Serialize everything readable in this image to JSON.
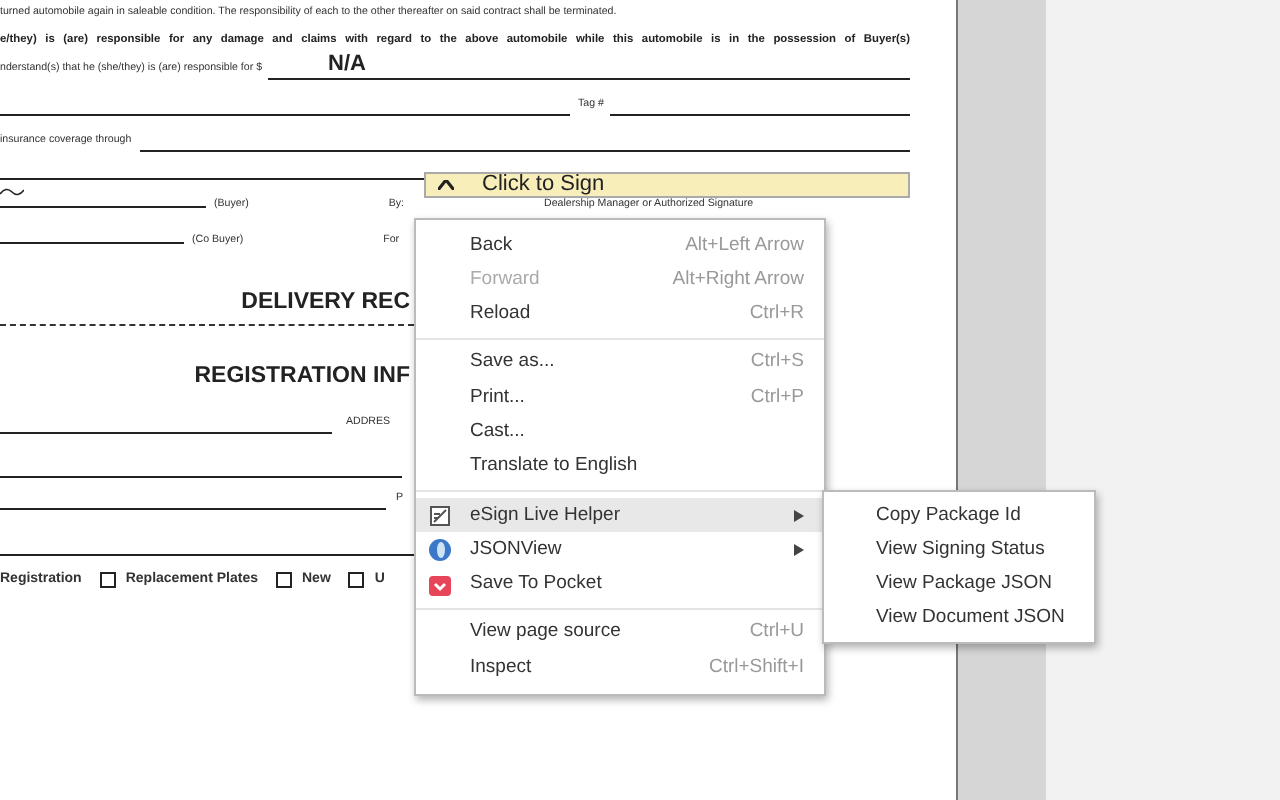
{
  "document": {
    "paragraph_1": "turned automobile again in saleable condition. The responsibility of each to the other thereafter on said contract shall be terminated.",
    "paragraph_2": "e/they) is (are) responsible for any damage and claims with regard to the above automobile while this automobile is in the possession of Buyer(s)",
    "amount_label": "nderstand(s) that he (she/they) is (are) responsible for $",
    "amount_value": "N/A",
    "tag_label": "Tag #",
    "insurance_label": "insurance coverage through",
    "buyer_label": "(Buyer)",
    "by_label": "By:",
    "sign_button": "Click to Sign",
    "signature_caption": "Dealership Manager or Authorized Signature",
    "co_buyer_label": "(Co Buyer)",
    "for_label": "For",
    "heading_1": "DELIVERY REC",
    "heading_2": "REGISTRATION INF",
    "address_label": "ADDRES",
    "po_label": "P",
    "registration_label": "Registration",
    "options": [
      {
        "label": "Replacement Plates",
        "checked": false
      },
      {
        "label": "New",
        "checked": false
      },
      {
        "label": "U",
        "checked": false
      }
    ]
  },
  "context_menu": {
    "items": [
      {
        "kind": "item",
        "label": "Back",
        "shortcut": "Alt+Left Arrow",
        "disabled": false,
        "selected": false
      },
      {
        "kind": "item",
        "label": "Forward",
        "shortcut": "Alt+Right Arrow",
        "disabled": true,
        "selected": false
      },
      {
        "kind": "item",
        "label": "Reload",
        "shortcut": "Ctrl+R",
        "disabled": false,
        "selected": false
      },
      {
        "kind": "separator"
      },
      {
        "kind": "item",
        "label": "Save as...",
        "shortcut": "Ctrl+S",
        "disabled": false,
        "selected": false
      },
      {
        "kind": "item",
        "label": "Print...",
        "shortcut": "Ctrl+P",
        "disabled": false,
        "selected": false
      },
      {
        "kind": "item",
        "label": "Cast...",
        "disabled": false,
        "selected": false
      },
      {
        "kind": "item",
        "label": "Translate to English",
        "disabled": false,
        "selected": false
      },
      {
        "kind": "separator"
      },
      {
        "kind": "extension",
        "label": "eSign Live Helper",
        "has_submenu": true,
        "disabled": false,
        "selected": true
      },
      {
        "kind": "extension",
        "label": "JSONView",
        "has_submenu": true,
        "disabled": false,
        "selected": false
      },
      {
        "kind": "extension",
        "label": "Save To Pocket",
        "disabled": false,
        "selected": false
      },
      {
        "kind": "separator"
      },
      {
        "kind": "item",
        "label": "View page source",
        "shortcut": "Ctrl+U",
        "disabled": false,
        "selected": false
      },
      {
        "kind": "item",
        "label": "Inspect",
        "shortcut": "Ctrl+Shift+I",
        "disabled": false,
        "selected": false
      }
    ]
  },
  "submenu": {
    "items": [
      {
        "label": "Copy Package Id"
      },
      {
        "label": "View Signing Status"
      },
      {
        "label": "View Package JSON"
      },
      {
        "label": "View Document JSON"
      }
    ]
  }
}
